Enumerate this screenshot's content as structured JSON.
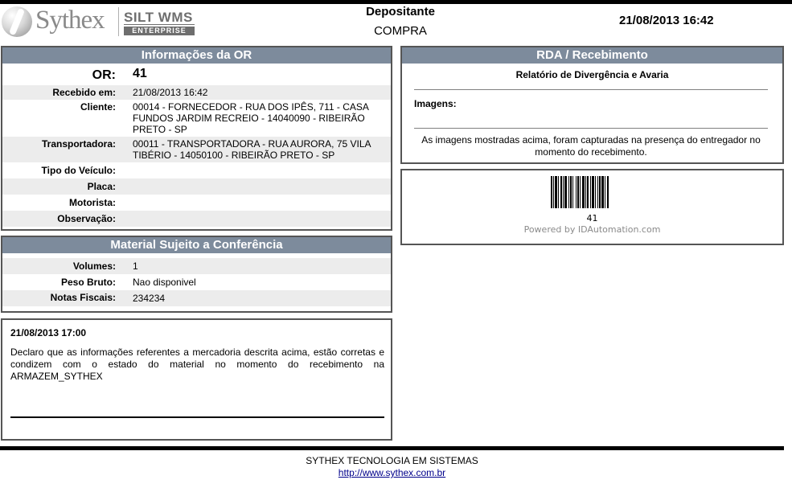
{
  "header": {
    "logo_text": "Sythex",
    "logo_product": "SILT WMS",
    "logo_edition": "ENTERPRISE",
    "title": "Depositante",
    "subtitle": "COMPRA",
    "datetime": "21/08/2013 16:42"
  },
  "or_info": {
    "title": "Informações da OR",
    "or_label": "OR:",
    "or_number": "41",
    "fields": [
      {
        "label": "Recebido em:",
        "value": "21/08/2013 16:42"
      },
      {
        "label": "Cliente:",
        "value": "00014 - FORNECEDOR - RUA DOS IPÊS, 711 - CASA FUNDOS JARDIM RECREIO - 14040090 - RIBEIRÃO PRETO - SP"
      },
      {
        "label": "Transportadora:",
        "value": "00011 - TRANSPORTADORA - RUA AURORA, 75 VILA TIBÉRIO - 14050100 - RIBEIRÃO PRETO - SP"
      },
      {
        "label": "Tipo do Veículo:",
        "value": ""
      },
      {
        "label": "Placa:",
        "value": ""
      },
      {
        "label": "Motorista:",
        "value": ""
      },
      {
        "label": "Observação:",
        "value": ""
      }
    ]
  },
  "material": {
    "title": "Material Sujeito a Conferência",
    "fields": [
      {
        "label": "Volumes:",
        "value": "1"
      },
      {
        "label": "Peso Bruto:",
        "value": "Nao disponivel"
      },
      {
        "label": "Notas Fiscais:",
        "value": "234234"
      }
    ]
  },
  "declaration": {
    "date": "21/08/2013 17:00",
    "text": "Declaro que as informações referentes a mercadoria descrita acima, estão corretas e condizem com o estado do material no momento do recebimento na ARMAZEM_SYTHEX"
  },
  "rda": {
    "title": "RDA / Recebimento",
    "subtitle": "Relatório de Divergência e Avaria",
    "images_label": "Imagens:",
    "note": "As imagens mostradas acima, foram capturadas na presença do entregador no momento do recebimento."
  },
  "barcode": {
    "number": "41",
    "powered_by": "Powered by IDAutomation.com"
  },
  "footer": {
    "company": "SYTHEX TECNOLOGIA EM SISTEMAS",
    "url": "http://www.sythex.com.br"
  }
}
